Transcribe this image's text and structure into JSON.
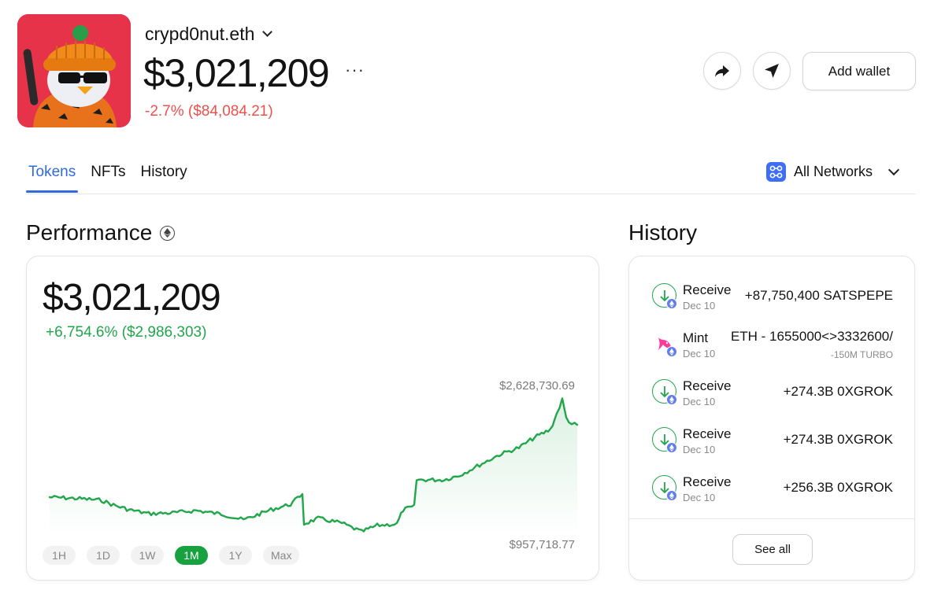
{
  "profile": {
    "wallet_name": "crypd0nut.eth",
    "balance": "$3,021,209",
    "more_label": "···",
    "change": "-2.7% ($84,084.21)",
    "change_color": "#f0504b"
  },
  "actions": {
    "share_icon": "share-arrow-icon",
    "send_icon": "send-plane-icon",
    "add_wallet_label": "Add wallet"
  },
  "tabs": [
    {
      "label": "Tokens",
      "active": true
    },
    {
      "label": "NFTs",
      "active": false
    },
    {
      "label": "History",
      "active": false
    }
  ],
  "network_filter": {
    "label": "All Networks"
  },
  "performance": {
    "title": "Performance",
    "value": "$3,021,209",
    "change": "+6,754.6% ($2,986,303)",
    "high_label": "$2,628,730.69",
    "low_label": "$957,718.77",
    "accent": "#21a64b",
    "ranges": [
      {
        "label": "1H",
        "active": false
      },
      {
        "label": "1D",
        "active": false
      },
      {
        "label": "1W",
        "active": false
      },
      {
        "label": "1M",
        "active": true
      },
      {
        "label": "1Y",
        "active": false
      },
      {
        "label": "Max",
        "active": false
      }
    ]
  },
  "history": {
    "title": "History",
    "items": [
      {
        "type": "Receive",
        "date": "Dec 10",
        "amount": "+87,750,400 SATSPEPE",
        "sub": ""
      },
      {
        "type": "Mint",
        "date": "Dec 10",
        "amount": "/ETH - 1655000<>3332600",
        "sub": "-150M TURBO"
      },
      {
        "type": "Receive",
        "date": "Dec 10",
        "amount": "+274.3B 0XGROK",
        "sub": ""
      },
      {
        "type": "Receive",
        "date": "Dec 10",
        "amount": "+274.3B 0XGROK",
        "sub": ""
      },
      {
        "type": "Receive",
        "date": "Dec 10",
        "amount": "+256.3B 0XGROK",
        "sub": ""
      }
    ],
    "see_all_label": "See all"
  }
}
